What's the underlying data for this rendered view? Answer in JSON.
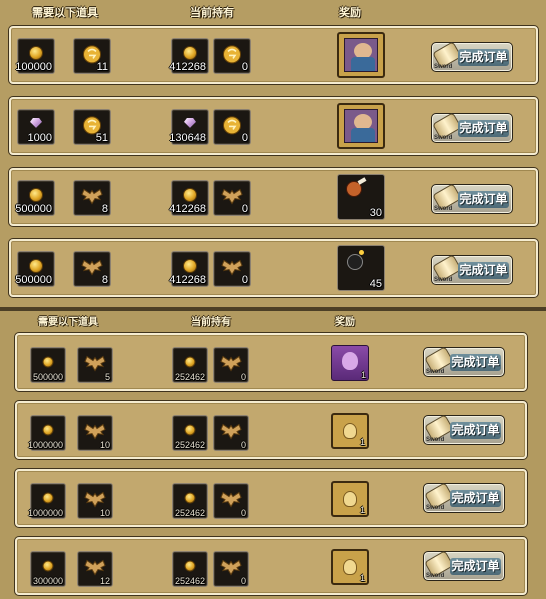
{
  "colors": {
    "gold": "#e0a624",
    "row_bg": "#c2a86e",
    "button_label_bg": "#56737f"
  },
  "headers": {
    "required": "需要以下道具",
    "held": "当前持有",
    "reward": "奖励"
  },
  "button": {
    "label": "完成订单",
    "sub": "Sword"
  },
  "panel1": {
    "rows": [
      {
        "req": [
          {
            "icon": "gold-coin-icon",
            "count": "100000"
          },
          {
            "icon": "gold-token-icon",
            "count": "11"
          }
        ],
        "held": [
          {
            "icon": "gold-coin-icon",
            "count": "412268"
          },
          {
            "icon": "gold-token-icon",
            "count": "0"
          }
        ],
        "reward": {
          "icon": "hero-portrait-icon",
          "count": ""
        }
      },
      {
        "req": [
          {
            "icon": "gem-icon",
            "count": "1000"
          },
          {
            "icon": "gold-token-icon",
            "count": "51"
          }
        ],
        "held": [
          {
            "icon": "gem-icon",
            "count": "130648"
          },
          {
            "icon": "gold-token-icon",
            "count": "0"
          }
        ],
        "reward": {
          "icon": "hero-portrait-icon",
          "count": ""
        }
      },
      {
        "req": [
          {
            "icon": "gold-coin-icon",
            "count": "500000"
          },
          {
            "icon": "bat-emblem-icon",
            "count": "8"
          }
        ],
        "held": [
          {
            "icon": "gold-coin-icon",
            "count": "412268"
          },
          {
            "icon": "bat-emblem-icon",
            "count": "0"
          }
        ],
        "reward": {
          "icon": "meat-icon",
          "count": "30"
        }
      },
      {
        "req": [
          {
            "icon": "gold-coin-icon",
            "count": "500000"
          },
          {
            "icon": "bat-emblem-icon",
            "count": "8"
          }
        ],
        "held": [
          {
            "icon": "gold-coin-icon",
            "count": "412268"
          },
          {
            "icon": "bat-emblem-icon",
            "count": "0"
          }
        ],
        "reward": {
          "icon": "bomb-icon",
          "count": "45"
        }
      }
    ]
  },
  "panel2": {
    "rows": [
      {
        "req": [
          {
            "icon": "gold-coin-icon",
            "count": "500000"
          },
          {
            "icon": "bat-emblem-icon",
            "count": "5"
          }
        ],
        "held": [
          {
            "icon": "gold-coin-icon",
            "count": "252462"
          },
          {
            "icon": "bat-emblem-icon",
            "count": "0"
          }
        ],
        "reward": {
          "icon": "purple-pouch-icon",
          "count": "1"
        }
      },
      {
        "req": [
          {
            "icon": "gold-coin-icon",
            "count": "1000000"
          },
          {
            "icon": "bat-emblem-icon",
            "count": "10"
          }
        ],
        "held": [
          {
            "icon": "gold-coin-icon",
            "count": "252462"
          },
          {
            "icon": "bat-emblem-icon",
            "count": "0"
          }
        ],
        "reward": {
          "icon": "gold-pouch-icon",
          "count": "1"
        }
      },
      {
        "req": [
          {
            "icon": "gold-coin-icon",
            "count": "1000000"
          },
          {
            "icon": "bat-emblem-icon",
            "count": "10"
          }
        ],
        "held": [
          {
            "icon": "gold-coin-icon",
            "count": "252462"
          },
          {
            "icon": "bat-emblem-icon",
            "count": "0"
          }
        ],
        "reward": {
          "icon": "gold-pouch-icon",
          "count": "1"
        }
      },
      {
        "req": [
          {
            "icon": "gold-coin-icon",
            "count": "300000"
          },
          {
            "icon": "bat-emblem-icon",
            "count": "12"
          }
        ],
        "held": [
          {
            "icon": "gold-coin-icon",
            "count": "252462"
          },
          {
            "icon": "bat-emblem-icon",
            "count": "0"
          }
        ],
        "reward": {
          "icon": "gold-pouch-icon",
          "count": "1"
        }
      }
    ]
  }
}
